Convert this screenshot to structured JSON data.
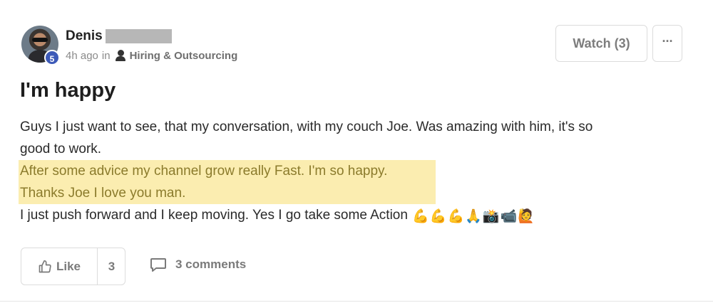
{
  "post": {
    "author": {
      "name": "Denis",
      "level": "5"
    },
    "meta": {
      "time": "4h ago",
      "in_text": "in",
      "group_icon": "group-icon",
      "group": "Hiring & Outsourcing"
    },
    "actions": {
      "watch_label": "Watch (3)",
      "more_label": "···"
    },
    "title": "I'm happy",
    "body": {
      "line1": "Guys I just want to see, that my conversation, with my couch Joe. Was amazing with him, it's so",
      "line2": "good to work.",
      "highlight1": "After some advice my channel grow really Fast. I'm so happy.",
      "highlight2": "Thanks Joe I love you man.",
      "line5": "I just push forward and I keep moving. Yes I go take some Action",
      "emojis": [
        "💪",
        "💪",
        "💪",
        "🙏",
        "📸",
        "📹",
        "🙋"
      ]
    },
    "footer": {
      "like_label": "Like",
      "like_count": "3",
      "comments_label": "3 comments"
    },
    "colors": {
      "highlight_bg": "#fbedb0",
      "highlight_text": "#8b7b2c",
      "badge": "#3d5ab8"
    }
  }
}
